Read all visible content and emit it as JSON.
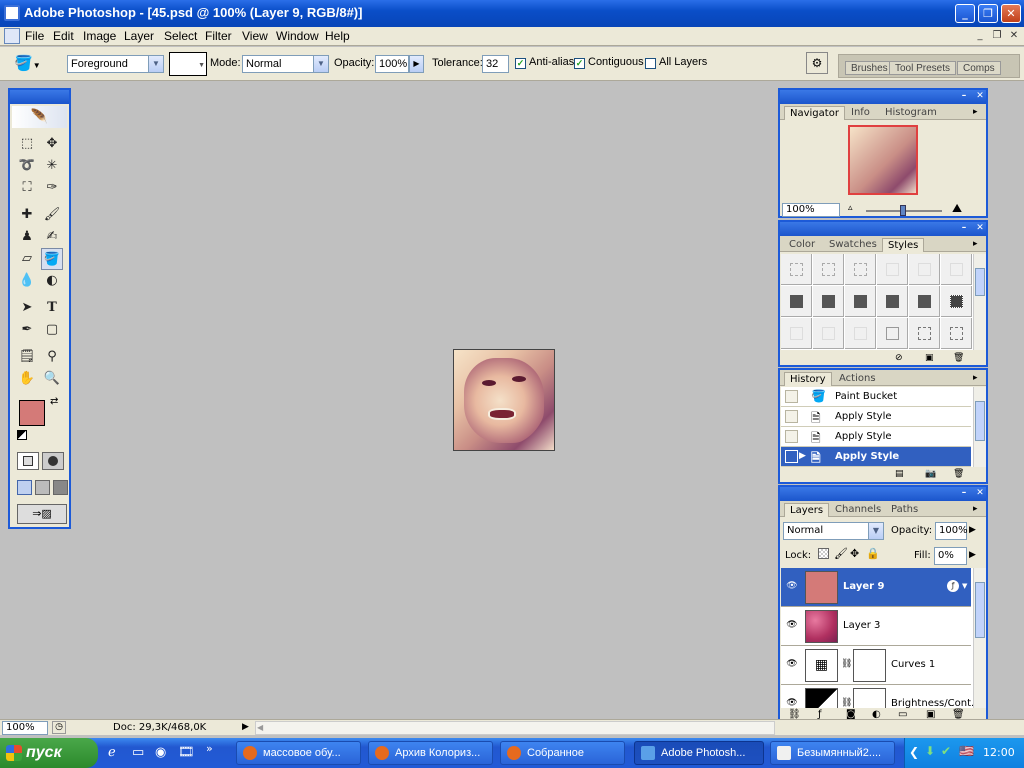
{
  "window": {
    "title": "Adobe Photoshop - [45.psd @ 100% (Layer 9, RGB/8#)]"
  },
  "menu": [
    "File",
    "Edit",
    "Image",
    "Layer",
    "Select",
    "Filter",
    "View",
    "Window",
    "Help"
  ],
  "options": {
    "preset": "Foreground",
    "mode_label": "Mode:",
    "mode_value": "Normal",
    "opacity_label": "Opacity:",
    "opacity_value": "100%",
    "tolerance_label": "Tolerance:",
    "tolerance_value": "32",
    "antialias_label": "Anti-alias",
    "antialias_checked": true,
    "contiguous_label": "Contiguous",
    "contiguous_checked": true,
    "alllayers_label": "All Layers",
    "alllayers_checked": false,
    "well_tabs": [
      "Brushes",
      "Tool Presets",
      "Comps"
    ]
  },
  "navigator": {
    "tabs": [
      "Navigator",
      "Info",
      "Histogram"
    ],
    "zoom": "100%"
  },
  "styles": {
    "tabs": [
      "Color",
      "Swatches",
      "Styles"
    ]
  },
  "history": {
    "tabs": [
      "History",
      "Actions"
    ],
    "items": [
      {
        "label": "Paint Bucket"
      },
      {
        "label": "Apply Style"
      },
      {
        "label": "Apply Style"
      },
      {
        "label": "Apply Style"
      }
    ]
  },
  "layers": {
    "tabs": [
      "Layers",
      "Channels",
      "Paths"
    ],
    "blend_mode": "Normal",
    "opacity_label": "Opacity:",
    "opacity_value": "100%",
    "lock_label": "Lock:",
    "fill_label": "Fill:",
    "fill_value": "0%",
    "items": [
      {
        "name": "Layer 9"
      },
      {
        "name": "Layer 3"
      },
      {
        "name": "Curves 1"
      },
      {
        "name": "Brightness/Cont..."
      }
    ]
  },
  "status": {
    "zoom": "100%",
    "doc": "Doc: 29,3K/468,0K"
  },
  "colors": {
    "foreground": "#d47a78",
    "background": "#ffffff",
    "selection": "#3160c0"
  },
  "taskbar": {
    "start": "пуск",
    "tasks": [
      {
        "label": "массовое обу..."
      },
      {
        "label": "Архив Колориз..."
      },
      {
        "label": "Собранное"
      },
      {
        "label": "Adobe Photosh..."
      },
      {
        "label": "Безымянный2...."
      }
    ],
    "clock": "12:00"
  }
}
